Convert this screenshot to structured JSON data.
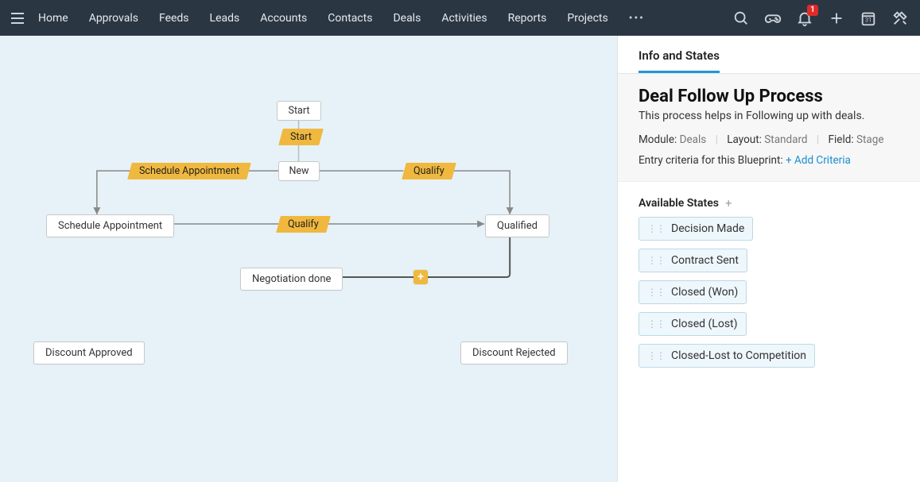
{
  "nav": {
    "items": [
      "Home",
      "Approvals",
      "Feeds",
      "Leads",
      "Accounts",
      "Contacts",
      "Deals",
      "Activities",
      "Reports",
      "Projects"
    ],
    "overflow": "•••",
    "notification_count": "1"
  },
  "canvas": {
    "nodes": {
      "start": "Start",
      "new": "New",
      "schedule_appointment": "Schedule Appointment",
      "qualified": "Qualified",
      "negotiation_done": "Negotiation done",
      "discount_approved": "Discount Approved",
      "discount_rejected": "Discount Rejected"
    },
    "transitions": {
      "start_t": "Start",
      "schedule_appt": "Schedule Appointment",
      "qualify_top": "Qualify",
      "qualify_mid": "Qualify"
    },
    "plus_handle": "+"
  },
  "panel": {
    "tab": "Info and States",
    "title": "Deal Follow Up Process",
    "description": "This process helps in Following up with deals.",
    "meta": {
      "module_label": "Module:",
      "module_value": "Deals",
      "layout_label": "Layout:",
      "layout_value": "Standard",
      "field_label": "Field:",
      "field_value": "Stage"
    },
    "criteria_label": "Entry criteria for this Blueprint:",
    "criteria_link": "+ Add Criteria",
    "states_header": "Available States",
    "states_add": "+",
    "states": [
      "Decision Made",
      "Contract Sent",
      "Closed (Won)",
      "Closed (Lost)",
      "Closed-Lost to Competition"
    ]
  }
}
